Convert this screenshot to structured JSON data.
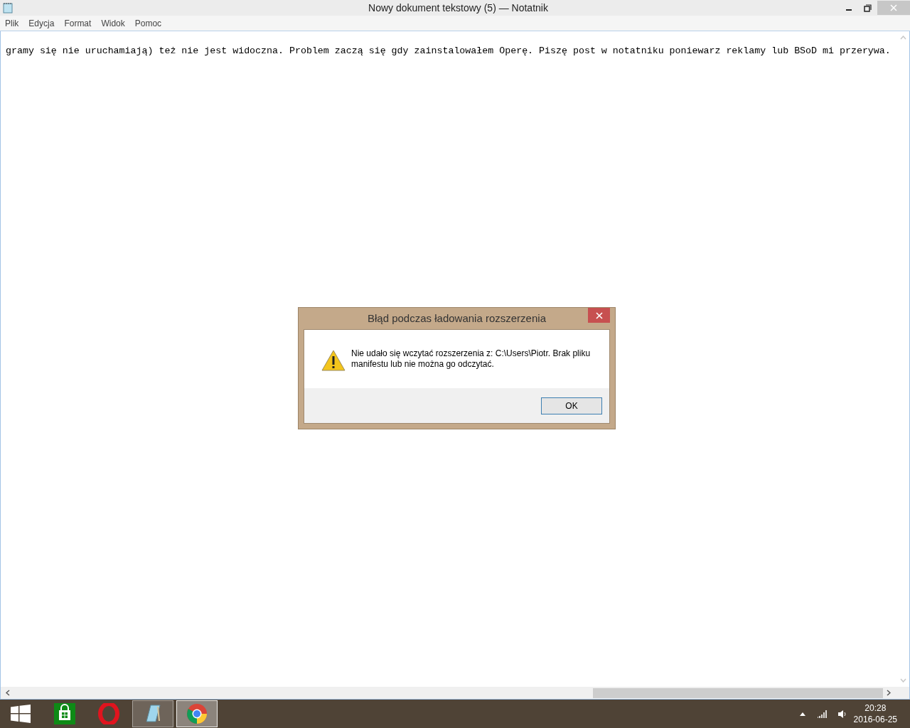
{
  "window": {
    "title": "Nowy dokument tekstowy (5) — Notatnik"
  },
  "menu": [
    "Plik",
    "Edycja",
    "Format",
    "Widok",
    "Pomoc"
  ],
  "document": {
    "text": "gramy się nie uruchamiają) też nie jest widoczna. Problem zaczą się gdy zainstalowałem Operę. Piszę post w notatniku poniewarz reklamy lub BSoD mi przerywa."
  },
  "dialog": {
    "title": "Błąd podczas ładowania rozszerzenia",
    "message": "Nie udało się wczytać rozszerzenia z: C:\\Users\\Piotr. Brak pliku manifestu lub nie można go odczytać.",
    "buttons": [
      "OK"
    ]
  },
  "taskbar": {
    "apps": [
      {
        "kind": "start",
        "running": false,
        "selected": false
      },
      {
        "kind": "store",
        "running": false,
        "selected": false
      },
      {
        "kind": "opera",
        "running": false,
        "selected": false
      },
      {
        "kind": "notepad",
        "running": true,
        "selected": false
      },
      {
        "kind": "chrome",
        "running": true,
        "selected": true
      }
    ],
    "time": "20:28",
    "date": "2016-06-25"
  }
}
